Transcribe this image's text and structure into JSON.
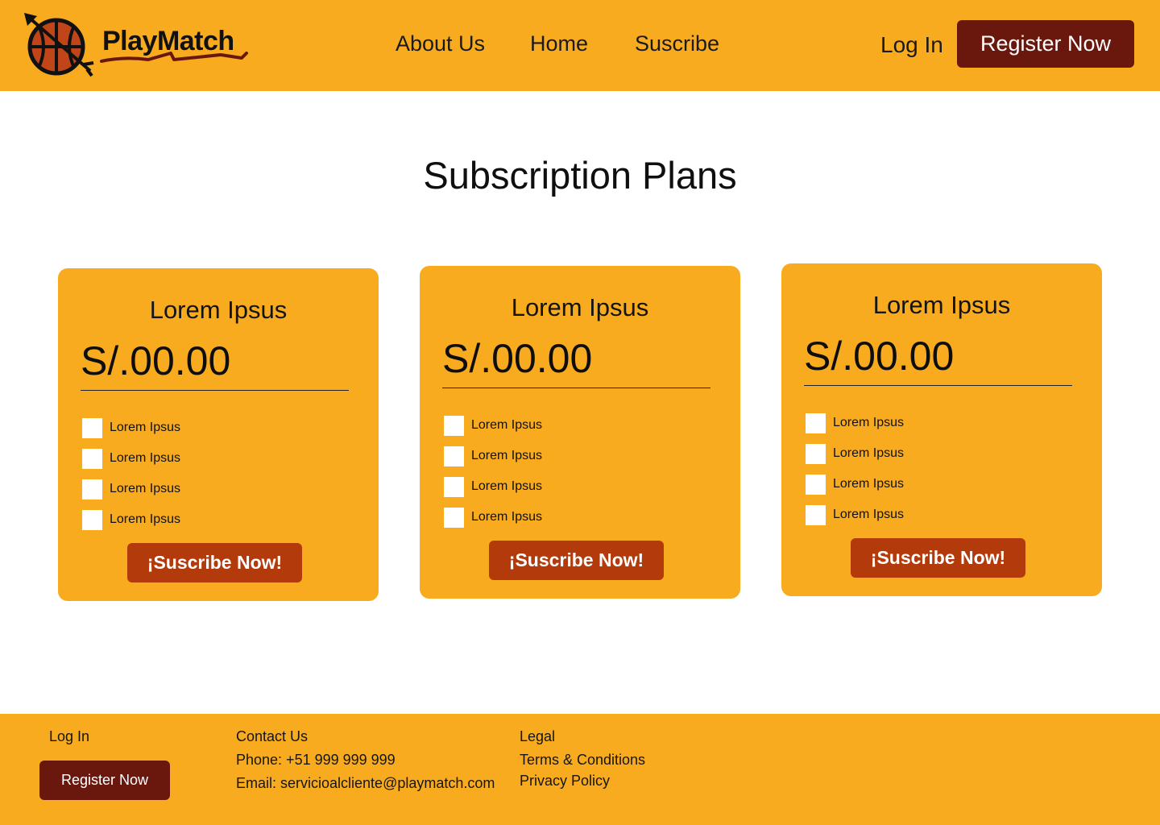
{
  "header": {
    "brand": "PlayMatch",
    "nav": [
      "About Us",
      "Home",
      "Suscribe"
    ],
    "login": "Log In",
    "register": "Register Now"
  },
  "main": {
    "title": "Subscription Plans",
    "plans": [
      {
        "name": "Lorem Ipsus",
        "price": "S/.00.00",
        "features": [
          "Lorem Ipsus",
          "Lorem Ipsus",
          "Lorem Ipsus",
          "Lorem Ipsus"
        ],
        "cta": "¡Suscribe Now!"
      },
      {
        "name": "Lorem Ipsus",
        "price": "S/.00.00",
        "features": [
          "Lorem Ipsus",
          "Lorem Ipsus",
          "Lorem Ipsus",
          "Lorem Ipsus"
        ],
        "cta": "¡Suscribe Now!"
      },
      {
        "name": "Lorem Ipsus",
        "price": "S/.00.00",
        "features": [
          "Lorem Ipsus",
          "Lorem Ipsus",
          "Lorem Ipsus",
          "Lorem Ipsus"
        ],
        "cta": "¡Suscribe Now!"
      }
    ]
  },
  "footer": {
    "login": "Log In",
    "register": "Register Now",
    "contact_title": "Contact Us",
    "phone": "Phone: +51 999 999 999",
    "email": "Email: servicioalcliente@playmatch.com",
    "legal_title": "Legal",
    "terms": "Terms & Conditions",
    "privacy": "Privacy Policy"
  },
  "colors": {
    "primary": "#F8AB1F",
    "dark_accent": "#6A180E",
    "cta": "#B23A0B"
  },
  "icons": {
    "logo": "basketball-arrow-icon"
  }
}
